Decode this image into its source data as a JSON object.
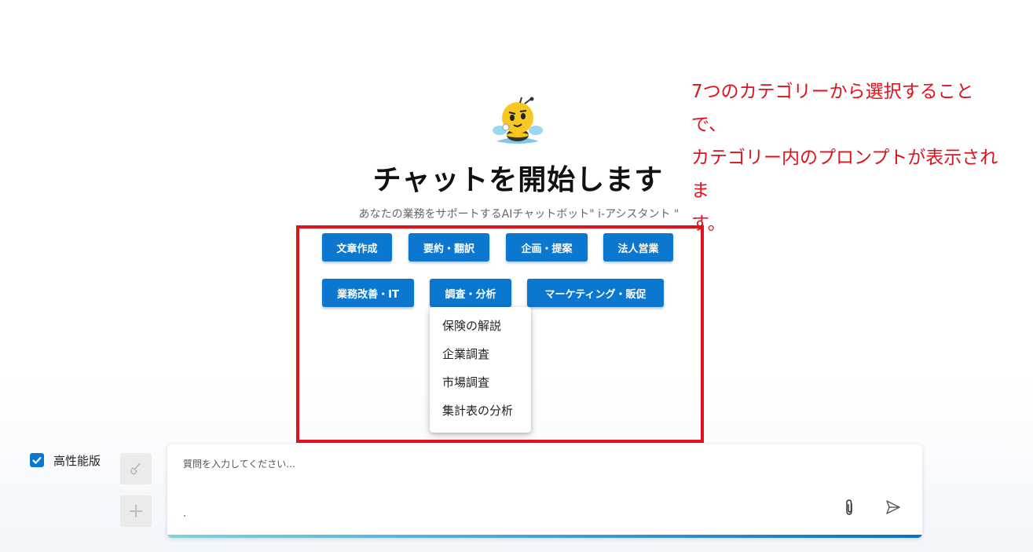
{
  "hero": {
    "title": "チャットを開始します",
    "subtitle": "あなたの業務をサポートするAIチャットボット\" i-アシスタント \""
  },
  "annotation": {
    "text": "7つのカテゴリーから選択することで、\nカテゴリー内のプロンプトが表示されま\nす。",
    "color": "#e0121b"
  },
  "categories": [
    {
      "label": "文章作成"
    },
    {
      "label": "要約・翻訳"
    },
    {
      "label": "企画・提案"
    },
    {
      "label": "法人営業"
    },
    {
      "label": "業務改善・IT"
    },
    {
      "label": "調査・分析"
    },
    {
      "label": "マーケティング・販促"
    }
  ],
  "dropdown": {
    "parent": "調査・分析",
    "items": [
      {
        "label": "保険の解説"
      },
      {
        "label": "企業調査"
      },
      {
        "label": "市場調査"
      },
      {
        "label": "集計表の分析"
      }
    ]
  },
  "controls": {
    "high_performance_label": "高性能版",
    "high_performance_checked": true,
    "clear_icon": "broom-icon",
    "new_chat_icon": "plus-icon"
  },
  "chat": {
    "placeholder": "質問を入力してください...",
    "attach_icon": "paperclip-icon",
    "send_icon": "send-icon"
  },
  "colors": {
    "accent": "#0b77cf",
    "annotation": "#e0121b"
  }
}
